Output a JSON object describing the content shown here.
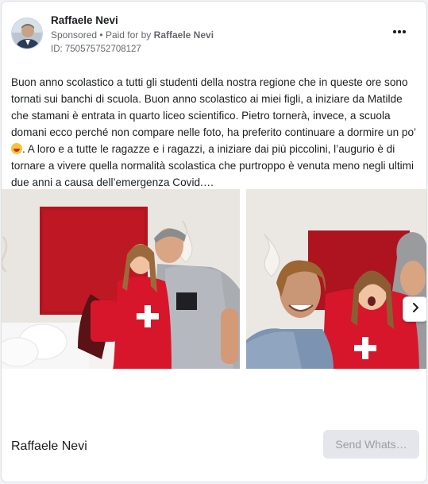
{
  "ad": {
    "page_name": "Raffaele Nevi",
    "sponsored_label": "Sponsored",
    "separator": "•",
    "paid_for_prefix": "Paid for by",
    "paid_for_name": "Raffaele Nevi",
    "ad_id": "ID: 750575752708127",
    "text_part1": "Buon anno scolastico a tutti gli studenti della nostra regione che in queste ore sono tornati sui banchi di scuola. Buon anno scolastico ai miei figli, a iniziare da Matilde che stamani è entrata in quarto liceo scientifico. Pietro tornerà, invece, a scuola domani ecco perché non compare nelle foto, ha preferito continuare a dormire un po’",
    "text_part2": ". A loro e a tutte le ragazze e i ragazzi, a iniziare dai più piccolini, l’augurio è di tornare a vivere quella normalità scolastica che purtroppo è venuta meno negli ultimi due anni a causa dell’emergenza Covid.…",
    "footer_page_name": "Raffaele Nevi",
    "cta_label": "Send Whats…"
  },
  "icons": {
    "more": "more-options-icon",
    "next": "chevron-right-icon",
    "emoji": "grinning-face-emoji"
  },
  "colors": {
    "card_bg": "#ffffff",
    "muted_text": "#65676b",
    "cta_bg": "#e4e6eb",
    "cta_text": "#9a9ca1"
  }
}
